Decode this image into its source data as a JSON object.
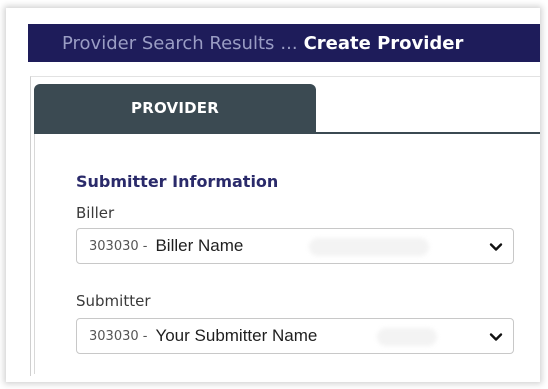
{
  "breadcrumb": {
    "parent": "Provider Search Results",
    "separator": "...",
    "current": "Create Provider"
  },
  "tabs": [
    {
      "label": "PROVIDER",
      "active": true
    }
  ],
  "submitter_section": {
    "title": "Submitter Information",
    "biller": {
      "label": "Biller",
      "id": "303030 -",
      "name": "Biller Name"
    },
    "submitter": {
      "label": "Submitter",
      "id": "303030 -",
      "name": "Your Submitter Name"
    }
  },
  "colors": {
    "header_bg": "#1e1c5a",
    "tab_bg": "#3b4a52",
    "section_title": "#2a2a6a"
  },
  "icons": {
    "select_arrow": "chevron-down-icon"
  }
}
